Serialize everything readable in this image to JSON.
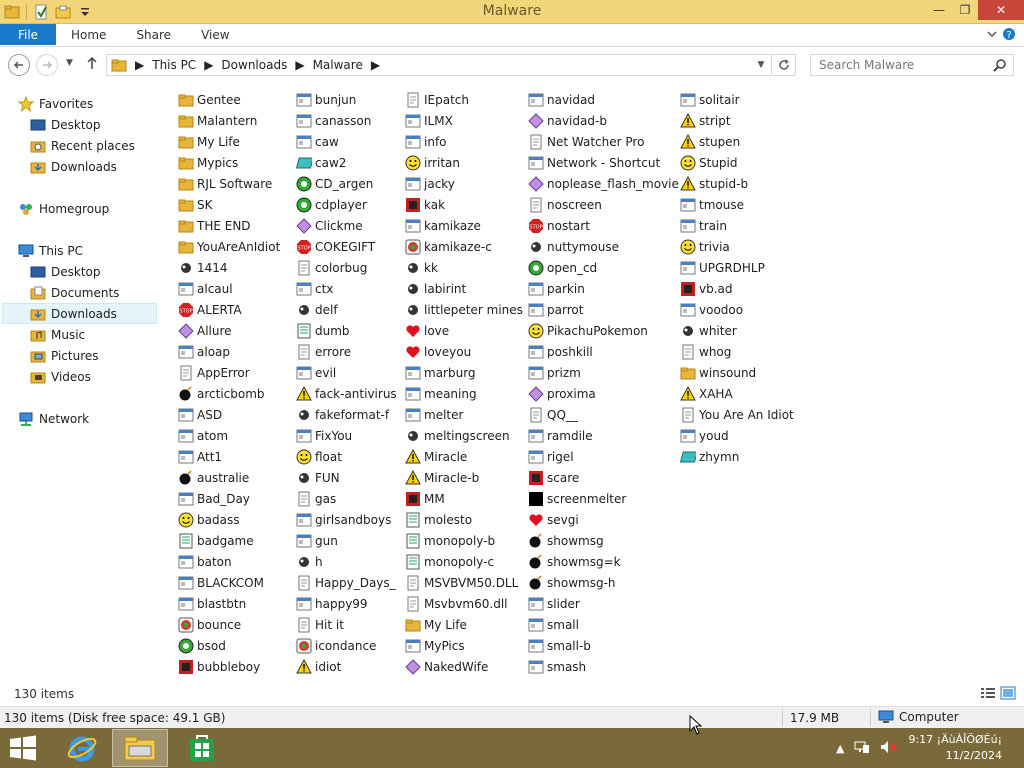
{
  "window": {
    "title": "Malware",
    "controls": {
      "minimize": "—",
      "maximize": "❐",
      "close": "✕"
    }
  },
  "ribbon": {
    "tabs": [
      "File",
      "Home",
      "Share",
      "View"
    ]
  },
  "address": {
    "crumbs": [
      "This PC",
      "Downloads",
      "Malware"
    ]
  },
  "search": {
    "placeholder": "Search Malware"
  },
  "nav": {
    "favorites": "Favorites",
    "desktop_fav": "Desktop",
    "recent": "Recent places",
    "downloads_fav": "Downloads",
    "homegroup": "Homegroup",
    "thispc": "This PC",
    "desktop": "Desktop",
    "documents": "Documents",
    "downloads": "Downloads",
    "music": "Music",
    "pictures": "Pictures",
    "videos": "Videos",
    "network": "Network"
  },
  "files": {
    "col1": [
      "Gentee",
      "Malantern",
      "My Life",
      "Mypics",
      "RJL Software",
      "SK",
      "THE END",
      "YouAreAnIdiot",
      "1414",
      "alcaul",
      "ALERTA",
      "Allure",
      "aloap",
      "AppError",
      "arcticbomb",
      "ASD",
      "atom",
      "Att1",
      "australie",
      "Bad_Day",
      "badass",
      "badgame",
      "baton",
      "BLACKCOM",
      "blastbtn",
      "bounce",
      "bsod",
      "bubbleboy"
    ],
    "col2": [
      "bunjun",
      "canasson",
      "caw",
      "caw2",
      "CD_argen",
      "cdplayer",
      "Clickme",
      "COKEGIFT",
      "colorbug",
      "ctx",
      "delf",
      "dumb",
      "errore",
      "evil",
      "fack-antivirus",
      "fakeformat-f",
      "FixYou",
      "float",
      "FUN",
      "gas",
      "girlsandboys",
      "gun",
      "h",
      "Happy_Days_",
      "happy99",
      "Hit it",
      "icondance",
      "idiot"
    ],
    "col3": [
      "IEpatch",
      "ILMX",
      "info",
      "irritan",
      "jacky",
      "kak",
      "kamikaze",
      "kamikaze-c",
      "kk",
      "labirint",
      "littlepeter mines",
      "love",
      "loveyou",
      "marburg",
      "meaning",
      "melter",
      "meltingscreen",
      "Miracle",
      "Miracle-b",
      "MM",
      "molesto",
      "monopoly-b",
      "monopoly-c",
      "MSVBVM50.DLL",
      "Msvbvm60.dll",
      "My Life",
      "MyPics",
      "NakedWife"
    ],
    "col4": [
      "navidad",
      "navidad-b",
      "Net Watcher Pro",
      "Network - Shortcut",
      "noplease_flash_movie",
      "noscreen",
      "nostart",
      "nuttymouse",
      "open_cd",
      "parkin",
      "parrot",
      "PikachuPokemon",
      "poshkill",
      "prizm",
      "proxima",
      "QQ__",
      "ramdile",
      "rigel",
      "scare",
      "screenmelter",
      "sevgi",
      "showmsg",
      "showmsg=k",
      "showmsg-h",
      "slider",
      "small",
      "small-b",
      "smash"
    ],
    "col5": [
      "solitair",
      "stript",
      "stupen",
      "Stupid",
      "stupid-b",
      "tmouse",
      "train",
      "trivia",
      "UPGRDHLP",
      "vb.ad",
      "voodoo",
      "whiter",
      "whog",
      "winsound",
      "XAHA",
      "You Are An Idiot",
      "youd",
      "zhymn"
    ]
  },
  "status": {
    "item_count": "130 items",
    "detail": "130 items (Disk free space: 49.1 GB)",
    "size": "17.9 MB",
    "location": "Computer"
  },
  "taskbar": {
    "time": "9:17 ¡ÄùÀÎÖØÉú¡",
    "date": "11/2/2024"
  },
  "colors": {
    "titlebar": "#f2d679",
    "file_tab": "#1979ca",
    "taskbar": "#7a6a3a",
    "selection": "#e5f3fb"
  }
}
